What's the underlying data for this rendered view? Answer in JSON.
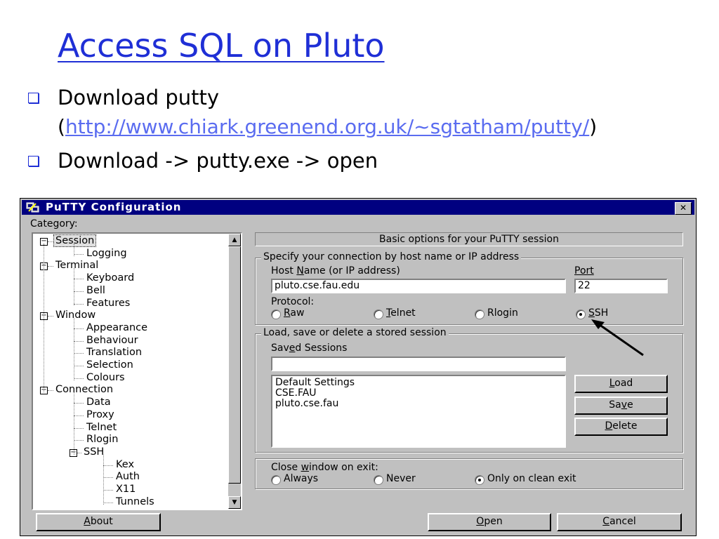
{
  "slide": {
    "title": "Access SQL on Pluto",
    "bullets": [
      {
        "text": "Download putty",
        "link_prefix": "(",
        "link": "http://www.chiark.greenend.org.uk/~sgtatham/putty/",
        "link_suffix": ")"
      },
      {
        "text": "Download -> putty.exe -> open"
      }
    ]
  },
  "window": {
    "title": "PuTTY Configuration",
    "close": "✕",
    "category_label": "Category:",
    "tree": [
      {
        "label": "Session",
        "level": 0,
        "expander": "−",
        "selected": true
      },
      {
        "label": "Logging",
        "level": 1
      },
      {
        "label": "Terminal",
        "level": 0,
        "expander": "−"
      },
      {
        "label": "Keyboard",
        "level": 1
      },
      {
        "label": "Bell",
        "level": 1
      },
      {
        "label": "Features",
        "level": 1
      },
      {
        "label": "Window",
        "level": 0,
        "expander": "−"
      },
      {
        "label": "Appearance",
        "level": 1
      },
      {
        "label": "Behaviour",
        "level": 1
      },
      {
        "label": "Translation",
        "level": 1
      },
      {
        "label": "Selection",
        "level": 1
      },
      {
        "label": "Colours",
        "level": 1
      },
      {
        "label": "Connection",
        "level": 0,
        "expander": "−"
      },
      {
        "label": "Data",
        "level": 1
      },
      {
        "label": "Proxy",
        "level": 1
      },
      {
        "label": "Telnet",
        "level": 1
      },
      {
        "label": "Rlogin",
        "level": 1
      },
      {
        "label": "SSH",
        "level": 1,
        "expander": "−"
      },
      {
        "label": "Kex",
        "level": 2
      },
      {
        "label": "Auth",
        "level": 2
      },
      {
        "label": "X11",
        "level": 2
      },
      {
        "label": "Tunnels",
        "level": 2
      }
    ],
    "panel_header": "Basic options for your PuTTY session",
    "connection_group": "Specify your connection by host name or IP address",
    "host_label_pre": "Host ",
    "host_label_ul": "N",
    "host_label_post": "ame (or IP address)",
    "host_value": "pluto.cse.fau.edu",
    "port_label": "Port",
    "port_value": "22",
    "protocol_label": "Protocol:",
    "protocols": [
      {
        "ul": "R",
        "rest": "aw",
        "selected": false
      },
      {
        "ul": "T",
        "rest": "elnet",
        "selected": false
      },
      {
        "ul": "",
        "rest": "Rlogin",
        "selected": false
      },
      {
        "ul": "S",
        "rest": "SH",
        "selected": true
      }
    ],
    "sessions_group": "Load, save or delete a stored session",
    "saved_label_pre": "Sav",
    "saved_label_ul": "e",
    "saved_label_post": "d Sessions",
    "saved_input": "",
    "sessions": [
      "Default Settings",
      "CSE.FAU",
      "pluto.cse.fau"
    ],
    "load": {
      "ul": "L",
      "rest": "oad"
    },
    "save": {
      "pre": "Sa",
      "ul": "v",
      "rest": "e"
    },
    "delete": {
      "ul": "D",
      "rest": "elete"
    },
    "close_label_pre": "Close ",
    "close_label_ul": "w",
    "close_label_post": "indow on exit:",
    "close_options": [
      {
        "label": "Always",
        "selected": false
      },
      {
        "label": "Never",
        "selected": false
      },
      {
        "label": "Only on clean exit",
        "selected": true
      }
    ],
    "about": {
      "ul": "A",
      "rest": "bout"
    },
    "open": {
      "ul": "O",
      "rest": "pen"
    },
    "cancel": {
      "ul": "C",
      "rest": "ancel"
    }
  }
}
